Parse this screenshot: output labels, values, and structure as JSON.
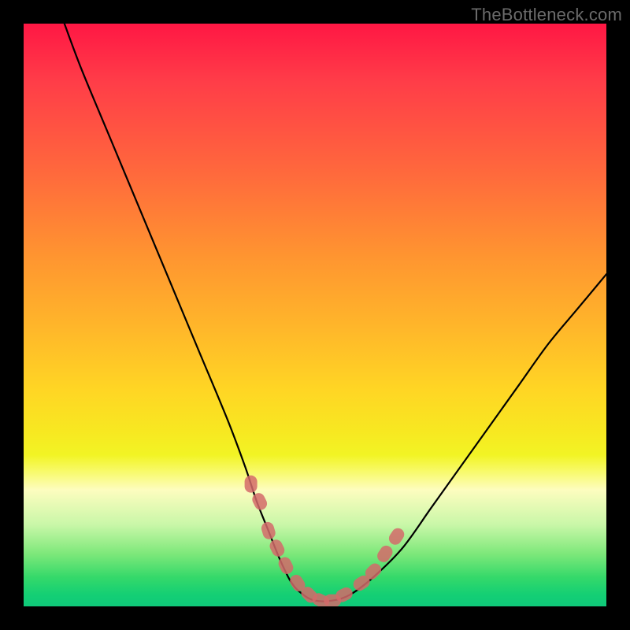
{
  "watermark": "TheBottleneck.com",
  "chart_data": {
    "type": "line",
    "title": "",
    "xlabel": "",
    "ylabel": "",
    "xlim": [
      0,
      100
    ],
    "ylim": [
      0,
      100
    ],
    "series": [
      {
        "name": "bottleneck-curve",
        "x": [
          7,
          10,
          15,
          20,
          25,
          30,
          35,
          38,
          40,
          42,
          44,
          46,
          48,
          50,
          53,
          56,
          60,
          65,
          70,
          75,
          80,
          85,
          90,
          95,
          100
        ],
        "y": [
          100,
          92,
          80,
          68,
          56,
          44,
          32,
          24,
          18,
          13,
          8,
          4,
          2,
          1,
          1,
          2,
          5,
          10,
          17,
          24,
          31,
          38,
          45,
          51,
          57
        ]
      }
    ],
    "markers": {
      "name": "highlighted-points",
      "x": [
        39,
        40.5,
        42,
        43.5,
        45,
        47,
        49,
        51,
        53,
        55,
        58,
        60,
        62,
        64
      ],
      "y": [
        21,
        18,
        13,
        10,
        7,
        4,
        2,
        1,
        1,
        2,
        4,
        6,
        9,
        12
      ]
    }
  }
}
